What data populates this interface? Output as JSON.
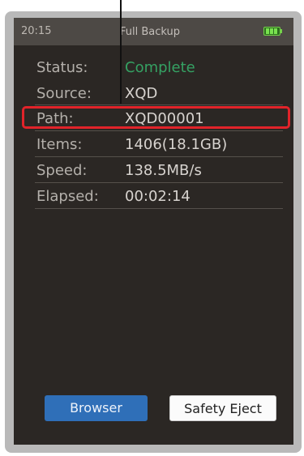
{
  "status_bar": {
    "time": "20:15",
    "mode_title": "Full Backup",
    "battery_icon": "battery-full-icon"
  },
  "info_rows": [
    {
      "label": "Status:",
      "value": "Complete",
      "value_color": "#35a163"
    },
    {
      "label": "Source:",
      "value": "XQD"
    },
    {
      "label": "Path:",
      "value": "XQD00001",
      "highlighted": true
    },
    {
      "label": "Items:",
      "value": "1406(18.1GB)"
    },
    {
      "label": "Speed:",
      "value": "138.5MB/s"
    },
    {
      "label": "Elapsed:",
      "value": "00:02:14"
    }
  ],
  "buttons": {
    "browser_label": "Browser",
    "eject_label": "Safety Eject"
  },
  "colors": {
    "screen_bg": "#2b2724",
    "status_bar_bg": "#4d4945",
    "highlight": "#e1232a",
    "browser_button": "#2f6fb8",
    "status_complete": "#35a163",
    "battery": "#74d24a"
  }
}
